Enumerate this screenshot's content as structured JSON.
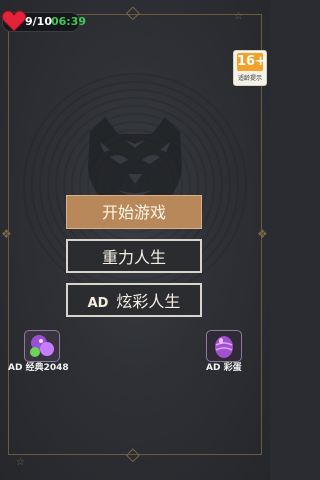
{
  "status": {
    "lives": "9/10",
    "timer": "06:39"
  },
  "age_badge": {
    "rating": "16+",
    "label": "适龄提示"
  },
  "menu": {
    "start_label": "开始游戏",
    "gravity_label": "重力人生",
    "colorful_ad": "AD",
    "colorful_label": "炫彩人生"
  },
  "side_ads": {
    "left_label": "AD 经典2048",
    "right_label": "AD 彩蛋"
  },
  "colors": {
    "gold": "#b8875a",
    "green": "#3ec95a",
    "heart": "#e2233a",
    "background": "#2e3035"
  }
}
